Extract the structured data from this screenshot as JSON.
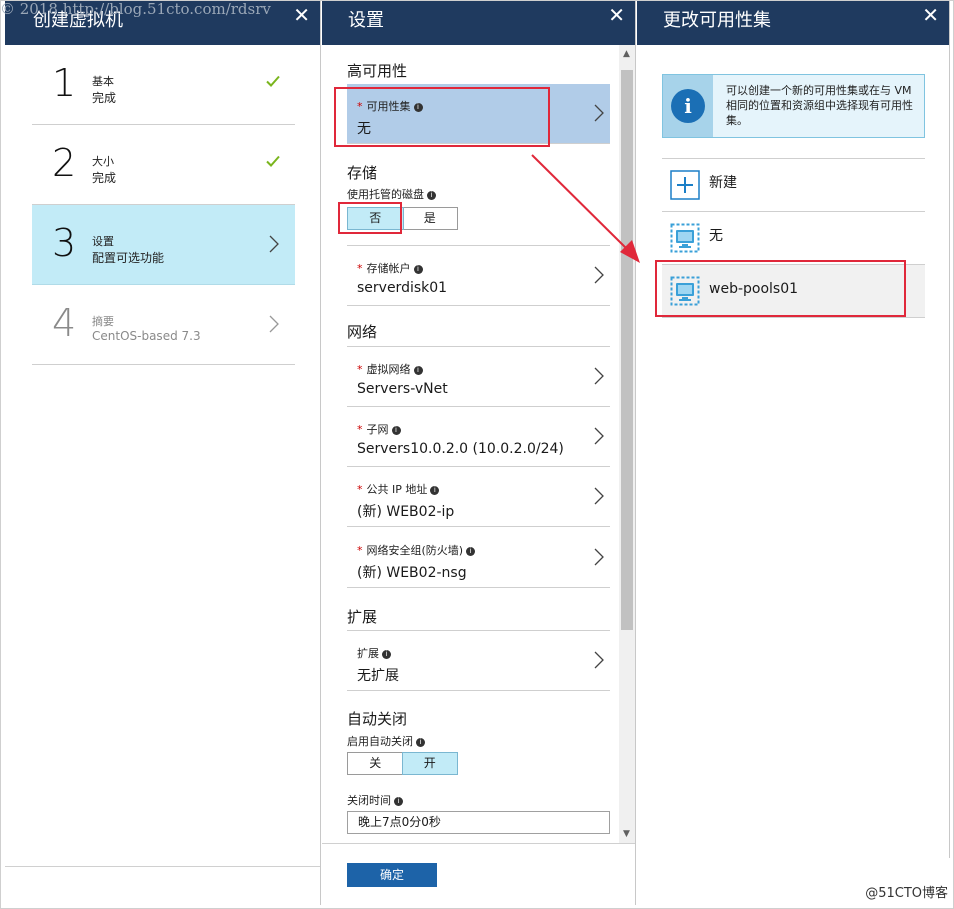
{
  "watermark": {
    "top": "© 2018 http://blog.51cto.com/rdsrv",
    "bottom": "@51CTO博客"
  },
  "blade1": {
    "title": "创建虚拟机",
    "close_icon": "close-icon",
    "steps": [
      {
        "num": "1",
        "name": "基本",
        "status": "完成",
        "state": "done"
      },
      {
        "num": "2",
        "name": "大小",
        "status": "完成",
        "state": "done"
      },
      {
        "num": "3",
        "name": "设置",
        "status": "配置可选功能",
        "state": "active"
      },
      {
        "num": "4",
        "name": "摘要",
        "status": "CentOS-based 7.3",
        "state": "disabled"
      }
    ]
  },
  "blade2": {
    "title": "设置",
    "sections": {
      "ha": "高可用性",
      "storage": "存储",
      "network": "网络",
      "extension": "扩展",
      "autoshutdown": "自动关闭"
    },
    "availability_set": {
      "label": "可用性集",
      "value": "无"
    },
    "managed_disk": {
      "label": "使用托管的磁盘",
      "no": "否",
      "yes": "是",
      "selected": "否"
    },
    "storage_account": {
      "label": "存储帐户",
      "value": "serverdisk01"
    },
    "vnet": {
      "label": "虚拟网络",
      "value": "Servers-vNet"
    },
    "subnet": {
      "label": "子网",
      "value": "Servers10.0.2.0 (10.0.2.0/24)"
    },
    "public_ip": {
      "label": "公共 IP 地址",
      "value": "(新) WEB02-ip"
    },
    "nsg": {
      "label": "网络安全组(防火墙)",
      "value": "(新) WEB02-nsg"
    },
    "extensions": {
      "label": "扩展",
      "value": "无扩展"
    },
    "auto_shutdown": {
      "label": "启用自动关闭",
      "off": "关",
      "on": "开",
      "selected": "开"
    },
    "shutdown_time": {
      "label": "关闭时间",
      "value": "晚上7点0分0秒"
    },
    "ok_label": "确定"
  },
  "blade3": {
    "title": "更改可用性集",
    "info_text": "可以创建一个新的可用性集或在与 VM 相同的位置和资源组中选择现有可用性集。",
    "items": [
      {
        "label": "新建",
        "icon": "plus-icon"
      },
      {
        "label": "无",
        "icon": "availability-set-icon"
      },
      {
        "label": "web-pools01",
        "icon": "availability-set-icon"
      }
    ]
  },
  "colors": {
    "header": "#1f3a5f",
    "active_step": "#c2ebf7",
    "selected_row": "#b1cce8",
    "annotation_red": "#e0283a",
    "ok_button": "#1d63a8"
  }
}
